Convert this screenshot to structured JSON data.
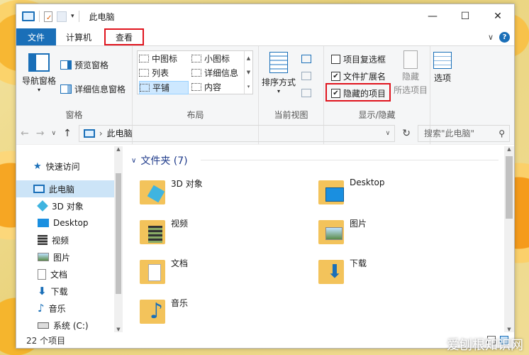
{
  "window": {
    "title": "此电脑"
  },
  "tabs": {
    "file": "文件",
    "computer": "计算机",
    "view": "查看"
  },
  "ribbon": {
    "panes": {
      "nav_pane": "导航窗格",
      "preview": "预览窗格",
      "details": "详细信息窗格",
      "label": "窗格"
    },
    "layout": {
      "medium": "中图标",
      "small": "小图标",
      "list": "列表",
      "details": "详细信息",
      "tiles": "平铺",
      "content": "内容",
      "label": "布局"
    },
    "current_view": {
      "sort": "排序方式",
      "label": "当前视图"
    },
    "show_hide": {
      "checkboxes": "项目复选框",
      "extensions": "文件扩展名",
      "hidden": "隐藏的项目",
      "hide_selected_1": "隐藏",
      "hide_selected_2": "所选项目",
      "label": "显示/隐藏"
    },
    "options": "选项"
  },
  "address": {
    "path": "此电脑",
    "search_placeholder": "搜索\"此电脑\""
  },
  "nav": {
    "quick": "快速访问",
    "pc": "此电脑",
    "d3": "3D 对象",
    "desktop": "Desktop",
    "video": "视频",
    "pictures": "图片",
    "docs": "文档",
    "downloads": "下载",
    "music": "音乐",
    "sysc": "系统 (C:)"
  },
  "folders": {
    "header": "文件夹 (7)",
    "d3": "3D 对象",
    "desktop": "Desktop",
    "video": "视频",
    "pictures": "图片",
    "docs": "文档",
    "downloads": "下载",
    "music": "音乐"
  },
  "status": "22 个项目",
  "watermark": "爱刨根知识网",
  "colors": {
    "accent": "#1a6fb8",
    "highlight": "#e0141e",
    "selected": "#cce4f7"
  }
}
